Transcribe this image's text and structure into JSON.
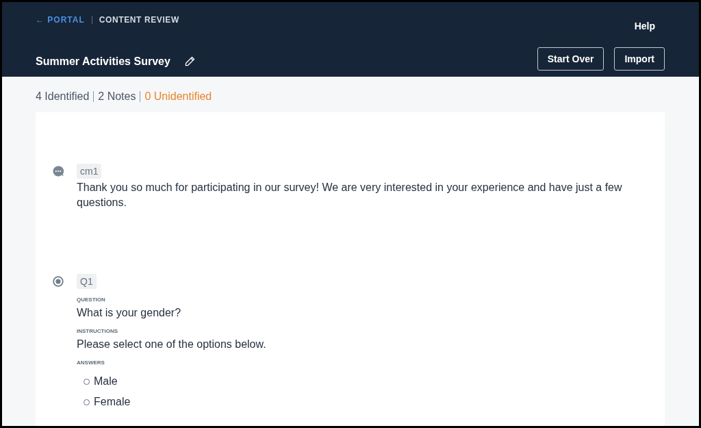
{
  "header": {
    "breadcrumb": {
      "back_link": "← PORTAL",
      "current": "CONTENT REVIEW"
    },
    "help_link": "Help",
    "title": "Summer Activities Survey",
    "buttons": [
      "Start Over",
      "Import"
    ]
  },
  "summary": [
    {
      "text": "4 Identified",
      "kind": "count"
    },
    {
      "text": "2 Notes",
      "kind": "count"
    },
    {
      "text": "0 Unidentified",
      "kind": "warning"
    }
  ],
  "items": [
    {
      "kind": "comment",
      "tag": "cm1",
      "text": "Thank you so much for participating in our survey! We are very interested in your experience and have just a few questions."
    },
    {
      "kind": "question",
      "tag": "Q1",
      "fields": [
        {
          "label": "QUESTION",
          "text": "What is your gender?"
        },
        {
          "label": "INSTRUCTIONS",
          "text": "Please select one of the options below."
        }
      ],
      "answers_label": "ANSWERS",
      "answers": [
        "Male",
        "Female"
      ]
    }
  ]
}
